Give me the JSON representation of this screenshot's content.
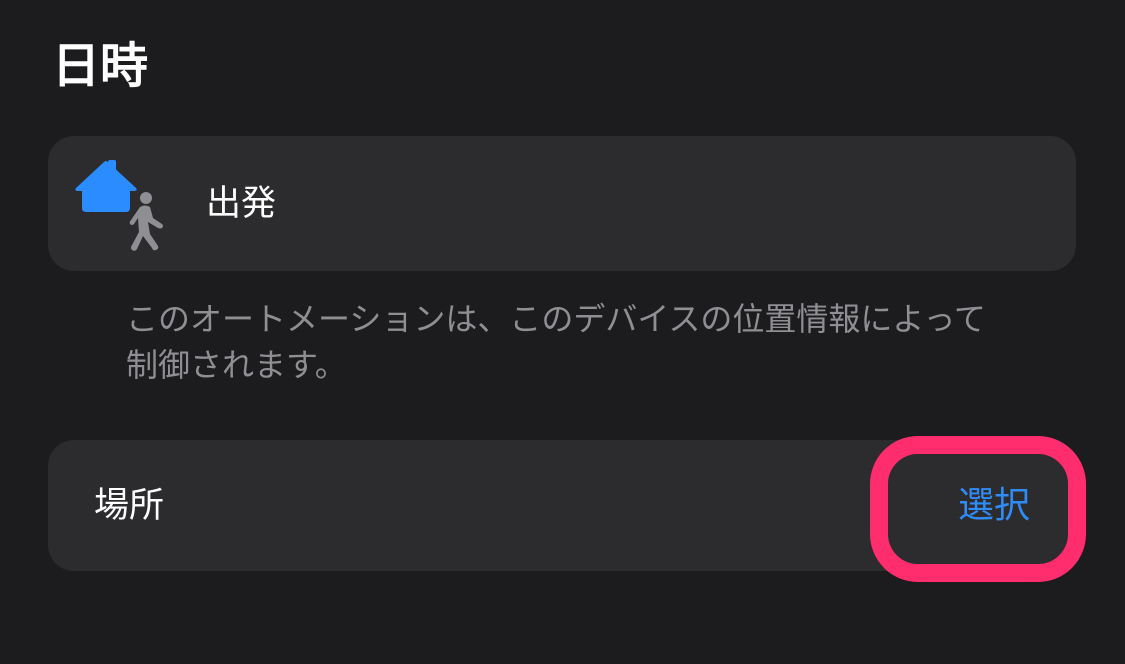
{
  "section": {
    "title": "日時"
  },
  "trigger": {
    "label": "出発",
    "icon": "home-leaving-person-icon",
    "icon_color": "#2a8cff"
  },
  "footnote": {
    "text": "このオートメーションは、このデバイスの位置情報によって制御されます。"
  },
  "location": {
    "label": "場所",
    "action_label": "選択",
    "action_color": "#2f8cf5"
  },
  "annotation": {
    "highlight_color": "#ff2d6e"
  }
}
